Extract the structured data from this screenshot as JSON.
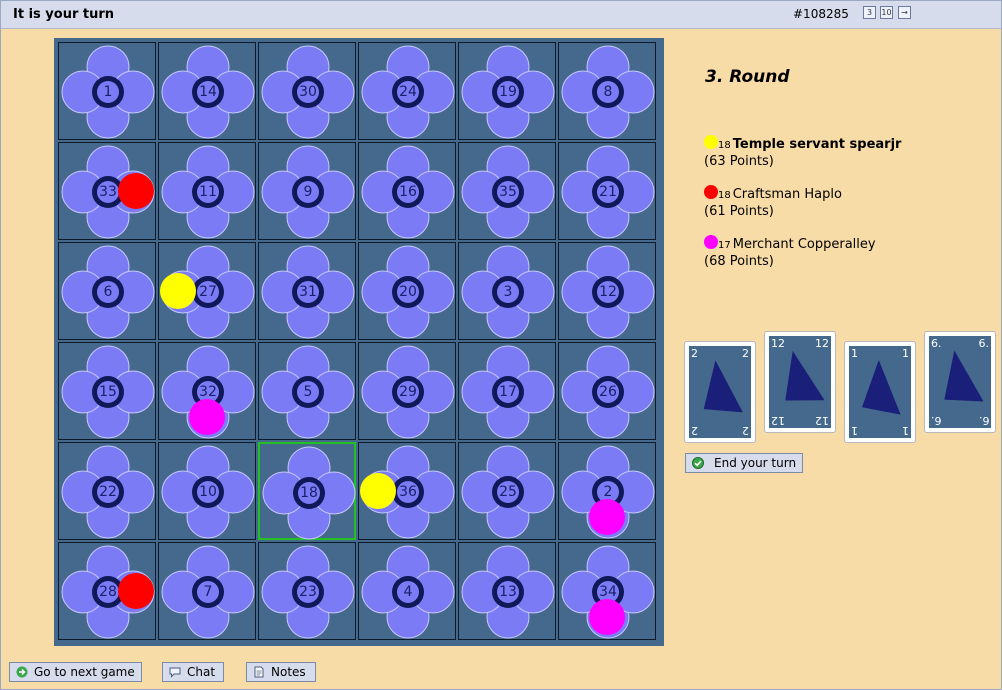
{
  "header": {
    "title": "It is your turn",
    "game_id": "#108285",
    "icons": [
      "rules-icon",
      "stats-icon",
      "exit-icon"
    ],
    "icon_glyphs": [
      "3",
      "10",
      "→"
    ]
  },
  "board": {
    "numbers": [
      [
        1,
        14,
        30,
        24,
        19,
        8
      ],
      [
        33,
        11,
        9,
        16,
        35,
        21
      ],
      [
        6,
        27,
        31,
        20,
        3,
        12
      ],
      [
        15,
        32,
        5,
        29,
        17,
        26
      ],
      [
        22,
        10,
        18,
        36,
        25,
        2
      ],
      [
        28,
        7,
        23,
        4,
        13,
        34
      ]
    ],
    "highlighted": {
      "row": 4,
      "col": 2
    },
    "pawns": [
      {
        "row": 1,
        "col": 0,
        "color": "#ff0000",
        "spot": "right"
      },
      {
        "row": 2,
        "col": 1,
        "color": "#ffff00",
        "spot": "left"
      },
      {
        "row": 3,
        "col": 1,
        "color": "#ff00ff",
        "spot": "bottom"
      },
      {
        "row": 4,
        "col": 3,
        "color": "#ffff00",
        "spot": "left"
      },
      {
        "row": 4,
        "col": 5,
        "color": "#ff00ff",
        "spot": "bottom"
      },
      {
        "row": 5,
        "col": 0,
        "color": "#ff0000",
        "spot": "right"
      },
      {
        "row": 5,
        "col": 5,
        "color": "#ff00ff",
        "spot": "bottom"
      }
    ],
    "colors": {
      "cell": "#44698c",
      "petal": "#7b7bf5",
      "petal_edge": "#c8c8ff",
      "center": "#101858",
      "highlight": "#22c022"
    }
  },
  "round_label": "3. Round",
  "players": [
    {
      "color": "#ffff00",
      "count": "18",
      "name": "Temple servant spearjr",
      "points": "(63 Points)",
      "bold": true
    },
    {
      "color": "#ff0000",
      "count": "18",
      "name": "Craftsman Haplo",
      "points": "(61 Points)",
      "bold": false
    },
    {
      "color": "#ff00ff",
      "count": "17",
      "name": "Merchant Copperalley",
      "points": "(68 Points)",
      "bold": false
    }
  ],
  "cards": [
    {
      "value": "2",
      "selected": false
    },
    {
      "value": "12",
      "selected": false
    },
    {
      "value": "1",
      "selected": false
    },
    {
      "value": "6.",
      "selected": false
    }
  ],
  "buttons": {
    "end_turn": "End your turn",
    "next_game": "Go to next game",
    "chat": "Chat",
    "notes": "Notes"
  }
}
